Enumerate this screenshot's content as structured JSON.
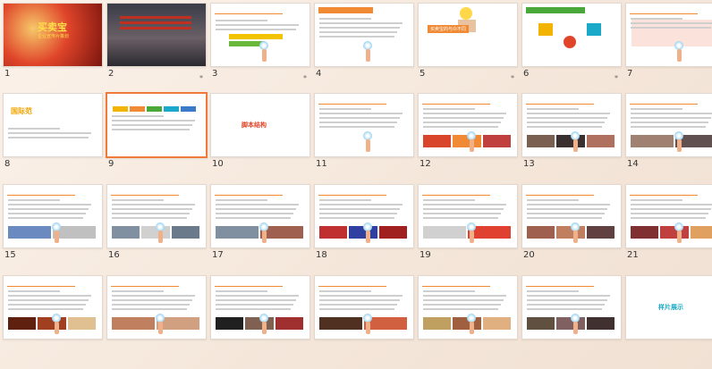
{
  "slides": [
    {
      "number": "1",
      "starred": false,
      "title": "买卖宝",
      "subtitle": "企业宣传片策划"
    },
    {
      "number": "2",
      "starred": true,
      "title": "",
      "subtitle": ""
    },
    {
      "number": "3",
      "starred": true,
      "title": "本视频片主要内容",
      "subtitle": ""
    },
    {
      "number": "4",
      "starred": false,
      "title": "买卖宝企业文化",
      "subtitle": ""
    },
    {
      "number": "5",
      "starred": true,
      "title": "",
      "subtitle": "买卖宝的与众不同"
    },
    {
      "number": "6",
      "starred": true,
      "title": "",
      "subtitle": ""
    },
    {
      "number": "7",
      "starred": false,
      "title": "",
      "subtitle": ""
    },
    {
      "number": "8",
      "starred": false,
      "title": "",
      "subtitle": "国际范"
    },
    {
      "number": "9",
      "starred": false,
      "title": "",
      "subtitle": "",
      "selected": true
    },
    {
      "number": "10",
      "starred": false,
      "title": "脚本结构",
      "subtitle": ""
    },
    {
      "number": "11",
      "starred": false,
      "title": "",
      "subtitle": ""
    },
    {
      "number": "12",
      "starred": false,
      "title": "",
      "subtitle": ""
    },
    {
      "number": "13",
      "starred": false,
      "title": "",
      "subtitle": ""
    },
    {
      "number": "14",
      "starred": false,
      "title": "",
      "subtitle": ""
    },
    {
      "number": "15",
      "starred": false,
      "title": "",
      "subtitle": ""
    },
    {
      "number": "16",
      "starred": false,
      "title": "",
      "subtitle": ""
    },
    {
      "number": "17",
      "starred": false,
      "title": "",
      "subtitle": ""
    },
    {
      "number": "18",
      "starred": false,
      "title": "",
      "subtitle": ""
    },
    {
      "number": "19",
      "starred": false,
      "title": "",
      "subtitle": ""
    },
    {
      "number": "20",
      "starred": false,
      "title": "",
      "subtitle": ""
    },
    {
      "number": "21",
      "starred": false,
      "title": "",
      "subtitle": ""
    },
    {
      "number": "",
      "starred": false,
      "title": "",
      "subtitle": ""
    },
    {
      "number": "",
      "starred": false,
      "title": "",
      "subtitle": ""
    },
    {
      "number": "",
      "starred": false,
      "title": "",
      "subtitle": ""
    },
    {
      "number": "",
      "starred": false,
      "title": "",
      "subtitle": ""
    },
    {
      "number": "",
      "starred": false,
      "title": "",
      "subtitle": ""
    },
    {
      "number": "",
      "starred": false,
      "title": "",
      "subtitle": ""
    },
    {
      "number": "",
      "starred": false,
      "title": "样片展示",
      "subtitle": ""
    }
  ],
  "star_glyph": "*",
  "colors": {
    "accent": "#f07a3a",
    "orange_bar": "#f08a34",
    "red": "#e0452a"
  }
}
